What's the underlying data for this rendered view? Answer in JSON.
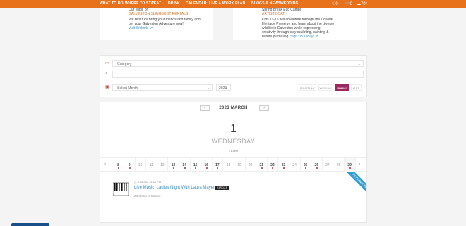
{
  "nav": {
    "items": [
      "WHAT TO DO",
      "WHERE TO STAY",
      "EAT",
      "DRINK",
      "CALENDAR",
      "LIVE & WORK",
      "PLAN",
      "BLOGS & NEWS",
      "WEDDING"
    ],
    "heart_count": "0",
    "cart_count": "0",
    "weather": "79°"
  },
  "left_card": {
    "line0": "Our Topic on",
    "title": "GALVESTON SLINGSHOT RENTALS",
    "line1": "We rent fun! Bring your friends and family and",
    "line2": "get your Galveston Adventure now!",
    "link": "Visit Website"
  },
  "right_card": {
    "line0": "Spring Break Eco Camps",
    "title": "ARTIST BOAT",
    "line1": "Kids 11-15 will adventure through the Coastal",
    "line2": "Heritage Preserve and learn about the diverse",
    "line3": "wildlife in Galveston while expressing",
    "line4": "creativity through clay sculpting, painting &",
    "line5": "nature journaling.",
    "link": "Sign Up Today!"
  },
  "filters": {
    "category_placeholder": "Category",
    "search_placeholder": "",
    "month_placeholder": "Select Month",
    "year": "2023",
    "views": [
      "MONTHLY",
      "WEEKLY",
      "DAILY",
      "LIST"
    ],
    "active_view": "DAILY"
  },
  "calendar": {
    "month_label": "2023 MARCH",
    "day_number": "1",
    "day_name": "WEDNESDAY",
    "event_count": "1 Event",
    "strip_days": [
      {
        "n": "8",
        "bold": true,
        "dot": true
      },
      {
        "n": "9",
        "bold": true,
        "dot": true
      },
      {
        "n": "10",
        "bold": false,
        "dot": false
      },
      {
        "n": "11",
        "bold": false,
        "dot": false
      },
      {
        "n": "12",
        "bold": false,
        "dot": false
      },
      {
        "n": "13",
        "bold": true,
        "dot": true
      },
      {
        "n": "14",
        "bold": true,
        "dot": true
      },
      {
        "n": "15",
        "bold": true,
        "dot": true
      },
      {
        "n": "16",
        "bold": true,
        "dot": true
      },
      {
        "n": "17",
        "bold": true,
        "dot": true
      },
      {
        "n": "18",
        "bold": false,
        "dot": false
      },
      {
        "n": "19",
        "bold": false,
        "dot": false
      },
      {
        "n": "20",
        "bold": false,
        "dot": false
      },
      {
        "n": "21",
        "bold": true,
        "dot": true
      },
      {
        "n": "22",
        "bold": true,
        "dot": true
      },
      {
        "n": "23",
        "bold": true,
        "dot": true
      },
      {
        "n": "24",
        "bold": false,
        "dot": false
      },
      {
        "n": "25",
        "bold": true,
        "dot": true
      },
      {
        "n": "26",
        "bold": true,
        "dot": true
      },
      {
        "n": "27",
        "bold": false,
        "dot": false
      },
      {
        "n": "28",
        "bold": false,
        "dot": false
      },
      {
        "n": "29",
        "bold": true,
        "dot": true
      }
    ]
  },
  "event": {
    "time": "5:30 PM - 9:30 PM",
    "title": "Live Music: Ladies Night With Laura Mayers",
    "tag": "23RD23",
    "location": "23rd Street Station",
    "ribbon": "FEATURED EVENT"
  },
  "colors": {
    "nav_bg": "#e8721c",
    "active_view_bg": "#9c2760",
    "link": "#3b8fbf",
    "ribbon": "#2f9dd0",
    "dot": "#b22a3a"
  }
}
